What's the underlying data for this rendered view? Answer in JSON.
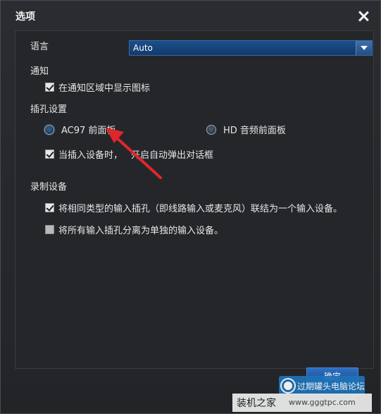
{
  "dialog": {
    "title": "选项"
  },
  "language": {
    "label": "语言",
    "value": "Auto"
  },
  "notification": {
    "heading": "通知",
    "show_icon_label": "在通知区域中显示图标",
    "show_icon_checked": true
  },
  "jack": {
    "heading": "插孔设置",
    "radio_ac97_label": "AC97 前面板",
    "radio_hd_label": "HD 音频前面板",
    "selected": "AC97 前面板",
    "auto_popup_label_a": "当插入设备时，",
    "auto_popup_label_b": "开启自动弹出对话框",
    "auto_popup_checked": true
  },
  "recording": {
    "heading": "录制设备",
    "combine_label": "将相同类型的输入插孔（即线路输入或麦克风）联结为一个输入设备。",
    "combine_checked": true,
    "separate_label": "将所有输入插孔分离为单独的输入设备。",
    "separate_checked": false
  },
  "buttons": {
    "ok": "确定"
  },
  "watermark": {
    "badge_text": "过期罐头电脑论坛",
    "site_cn": "装机之家",
    "site_url": "www.gggtpc.com"
  },
  "colors": {
    "dialog_bg": "#24262a",
    "accent": "#1c4f8c",
    "annotation_arrow": "#e0262a"
  }
}
